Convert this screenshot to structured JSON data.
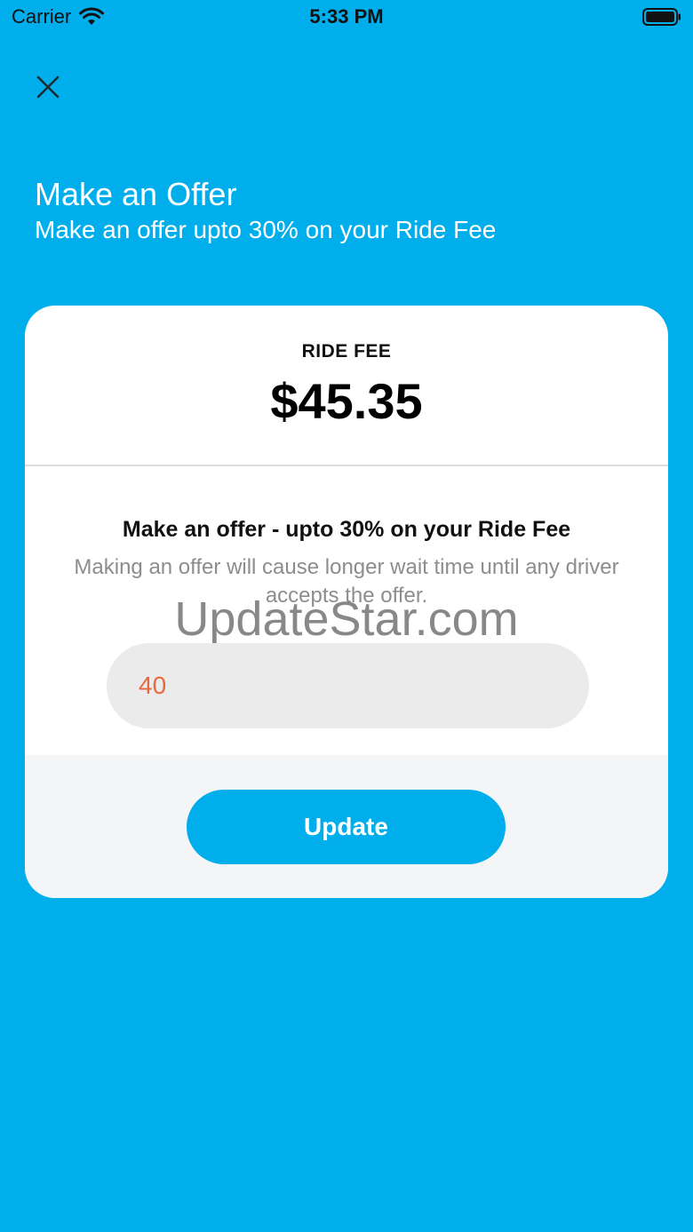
{
  "status_bar": {
    "carrier": "Carrier",
    "time": "5:33 PM"
  },
  "header": {
    "title": "Make an Offer",
    "subtitle": "Make an offer upto 30% on your Ride Fee"
  },
  "card": {
    "fee_label": "RIDE FEE",
    "fee_value": "$45.35",
    "offer_title": "Make an offer - upto 30% on your Ride Fee",
    "offer_description": "Making an offer will cause longer wait time until any driver accepts the offer.",
    "offer_input_value": "40",
    "update_label": "Update"
  },
  "watermark": "UpdateStar.com",
  "colors": {
    "background": "#00aeec",
    "accent": "#00aeec",
    "input_text": "#e8693c"
  },
  "icons": {
    "close": "close-icon",
    "wifi": "wifi-icon",
    "battery": "battery-icon"
  }
}
